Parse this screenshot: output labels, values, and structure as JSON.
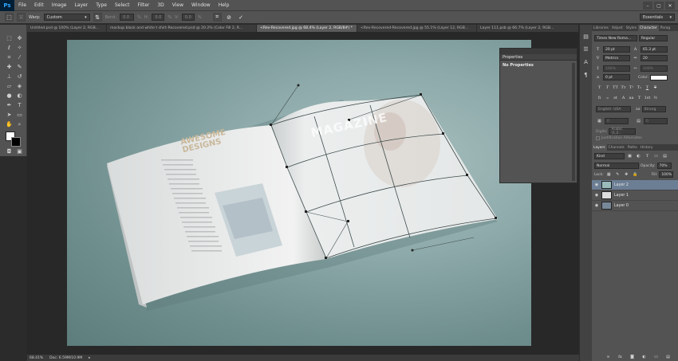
{
  "app": {
    "logo": "Ps",
    "menu": [
      "File",
      "Edit",
      "Image",
      "Layer",
      "Type",
      "Select",
      "Filter",
      "3D",
      "View",
      "Window",
      "Help"
    ],
    "window_controls": [
      "–",
      "▢",
      "✕"
    ]
  },
  "options": {
    "warp_label": "Warp:",
    "warp_value": "Custom",
    "bend_label": "Bend:",
    "bend_value": "0.0",
    "h_label": "H:",
    "h_value": "0.0",
    "v_label": "V:",
    "v_value": "0.0",
    "pct": "%",
    "cancel_glyph": "⊘",
    "commit_glyph": "✓",
    "workspace": "Essentials"
  },
  "tabs": [
    {
      "label": "Untitled.psd @ 100% (Layer 2, RGB...",
      "active": false
    },
    {
      "label": "mockup black and white t shirt-Recovered.psd @ 20.2% (Color Fill 2, R...",
      "active": false
    },
    {
      "label": "<Rev-Recovered.jpg @ 68.4% (Layer 2, RGB/8#) *",
      "active": true
    },
    {
      "label": "<Rev-Recovered-Recovered.jpg @ 55.1% (Layer 12, RGB...",
      "active": false
    },
    {
      "label": "Layer 111.psb @ 66.7% (Layer 2, RGB...",
      "active": false
    }
  ],
  "canvas": {
    "page_title_line1": "AWESOME",
    "page_title_line2": "DESIGNS",
    "page_overlay_word": "MAGAZINE"
  },
  "properties": {
    "tab": "Properties",
    "body": "No Properties"
  },
  "character": {
    "tabs": [
      "Libraries",
      "Adjust",
      "Styles",
      "Character",
      "Parag"
    ],
    "active_tab": "Character",
    "font_family": "Times New Roma...",
    "font_style": "Regular",
    "size": "20 pt",
    "leading": "65.3 pt",
    "kerning": "Metrics",
    "tracking": "20",
    "v_scale": "100%",
    "h_scale": "100%",
    "baseline": "0 pt",
    "color_label": "Color:",
    "type_buttons": [
      "T",
      "T",
      "TT",
      "Tт",
      "T¹",
      "T₁",
      "T",
      "T"
    ],
    "ot_buttons": [
      "fi",
      "ℴ",
      "st",
      "A",
      "aa",
      "T",
      "1st",
      "½"
    ],
    "language": "English: USA",
    "aa_label": "aa",
    "antialias": "Strong",
    "tsume": "0",
    "auto": "0",
    "digits_label": "Digits:",
    "digits": "Arabic (1,2...",
    "justification": "Justification Alternates"
  },
  "layers": {
    "tabs": [
      "Layers",
      "Channels",
      "Paths",
      "History"
    ],
    "active_tab": "Layers",
    "filter": "Kind",
    "blend": "Normal",
    "opacity_label": "Opacity:",
    "opacity": "70%",
    "lock_label": "Lock:",
    "fill_label": "Fill:",
    "fill": "100%",
    "items": [
      {
        "name": "Layer 2",
        "selected": true
      },
      {
        "name": "Layer 1",
        "selected": false
      },
      {
        "name": "Layer 0",
        "selected": false
      }
    ]
  },
  "status": {
    "zoom": "68.41%",
    "doc": "Doc: 6.59M/10.9M"
  }
}
